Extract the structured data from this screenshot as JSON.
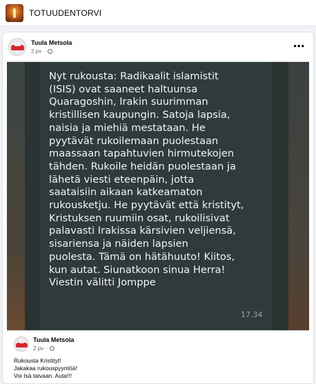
{
  "group": {
    "name": "TOTUUDENTORVI",
    "avatar_icon": "group-cover-icon"
  },
  "post": {
    "author": "Tuula Metsola",
    "time": "2 pv",
    "separator": "·",
    "audience_icon": "globe-icon",
    "more_icon": "more-options-icon",
    "more_label": "•••"
  },
  "image": {
    "message": "Nyt rukousta: Radikaalit islamistit\n(ISIS) ovat saaneet haltuunsa\nQuaragoshin, Irakin suurimman\nkristillisen kaupungin. Satoja lapsia,\nnaisia ja miehiä mestataan. He\npyytävät rukoilemaan puolestaan\nmaassaan tapahtuvien hirmutekojen\ntähden. Rukoile heidän puolestaan ja\nlähetä viesti eteenpäin, jotta\nsaataisiin aikaan katkeamaton\nrukousketju. He pyytävät että kristityt,\nKristuksen ruumiin osat, rukoilisivat\npalavasti Irakissa kärsivien veljiensä,\nsisariensa ja näiden lapsien\npuolesta. Tämä on hätähuuto! Kiitos,\nkun autat. Siunatkoon sinua Herra!\nViestin välitti Jomppe",
    "time": "17.34"
  },
  "shared_post": {
    "author": "Tuula Metsola",
    "time": "2 pv",
    "separator": "·",
    "lines": [
      "Rukousta Kristityt!",
      "Jakakaa rukouspyyntöä!",
      "Voi Isä taivaan. Auta!!!"
    ]
  }
}
